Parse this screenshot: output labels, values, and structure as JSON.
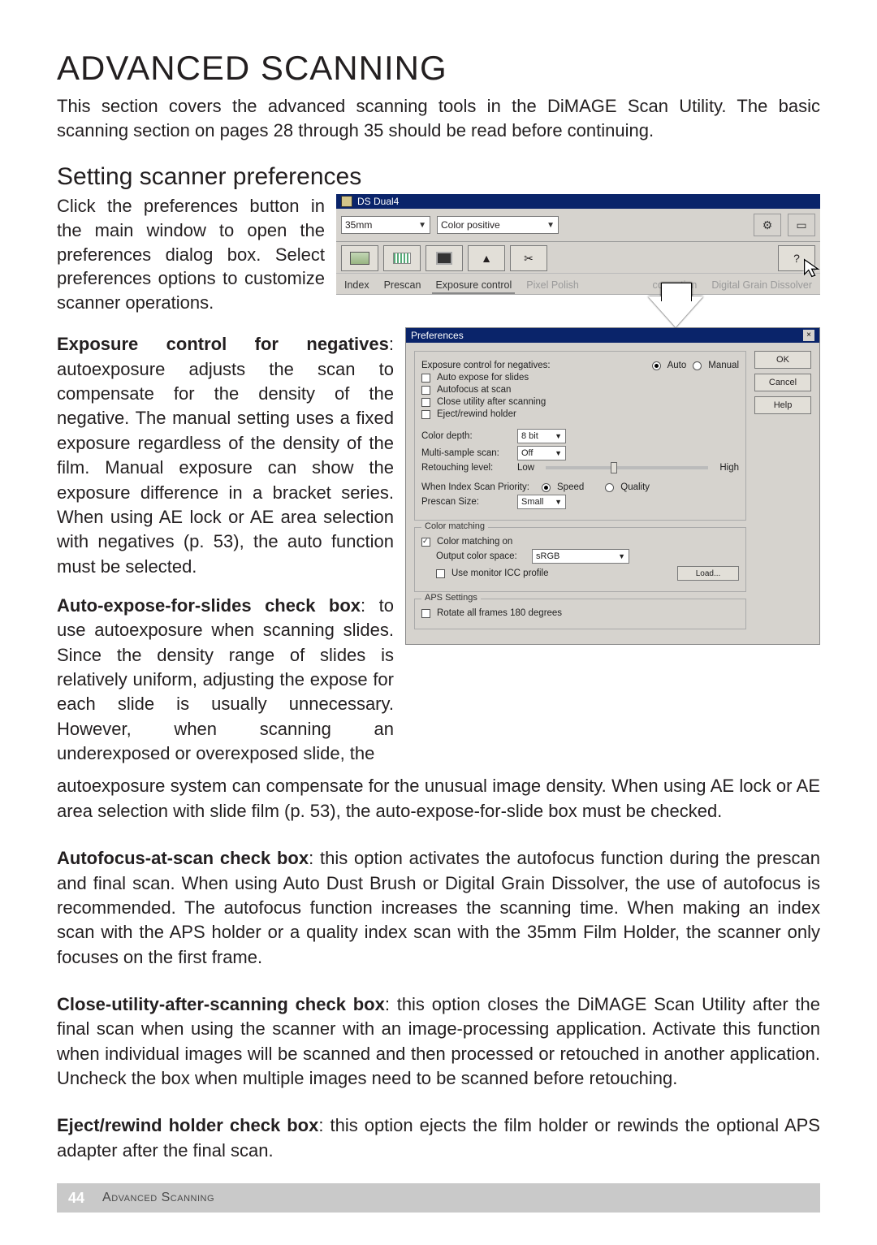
{
  "heading": "ADVANCED SCANNING",
  "intro": "This section covers the advanced scanning tools in the DiMAGE Scan Utility. The basic scanning section on pages 28 through 35 should be read before continuing.",
  "subheading": "Setting scanner preferences",
  "click_text": "Click the preferences button in the main window to open the preferences dialog box. Select preferences options to customize scanner operations.",
  "exposure": {
    "bold": "Exposure control for negatives",
    "text": ": autoexposure adjusts the scan to compensate for the density of the negative. The manual setting uses a fixed exposure regardless of the density of the film. Manual exposure can show the exposure difference in a bracket series. When using AE lock or AE area selection with negatives (p. 53), the auto function must be selected."
  },
  "autoexpose_slides": {
    "bold": "Auto-expose-for-slides check box",
    "text": ": to use autoexposure when scanning slides. Since the density range of slides is relatively uniform, adjusting the expose for each slide is usually unnecessary. However, when scanning an underexposed or overexposed slide, the"
  },
  "autoexpose_continued": "autoexposure system can compensate for the unusual image density. When using AE lock or AE area selection with slide film (p. 53), the auto-expose-for-slide box must be checked.",
  "autofocus": {
    "bold": "Autofocus-at-scan check box",
    "text": ": this option activates the autofocus function during the prescan and final scan. When using Auto Dust Brush or Digital Grain Dissolver, the use of autofocus is recommended. The autofocus function increases the scanning time. When making an index scan with the APS holder or a quality index scan with the 35mm Film Holder, the scanner only focuses on the first frame."
  },
  "close_util": {
    "bold": "Close-utility-after-scanning check box",
    "text": ": this option closes the DiMAGE Scan Utility after the final scan when using the scanner with an image-processing application. Activate this function when individual images will be scanned and then processed or retouched in another application. Uncheck the box when multiple images need to be scanned before retouching."
  },
  "eject": {
    "bold": "Eject/rewind holder check box",
    "text": ": this option ejects the film holder or rewinds the optional APS adapter after the final scan."
  },
  "footer": {
    "page": "44",
    "section": "Advanced Scanning"
  },
  "app": {
    "title": "DS Dual4",
    "film_format": "35mm",
    "film_type": "Color positive",
    "tabs": {
      "index": "Index",
      "prescan": "Prescan",
      "exposure": "Exposure control",
      "pixel": "Pixel Polish",
      "correction": "correction",
      "digital": "Digital Grain Dissolver"
    }
  },
  "pref": {
    "title": "Preferences",
    "ok": "OK",
    "cancel": "Cancel",
    "help": "Help",
    "exposure_label": "Exposure control for negatives:",
    "auto": "Auto",
    "manual": "Manual",
    "auto_expose_slides": "Auto expose for slides",
    "autofocus_at_scan": "Autofocus at scan",
    "close_utility": "Close utility after scanning",
    "eject_rewind": "Eject/rewind holder",
    "color_depth_label": "Color depth:",
    "color_depth_value": "8 bit",
    "multi_sample_label": "Multi-sample scan:",
    "multi_sample_value": "Off",
    "retouching_label": "Retouching level:",
    "low": "Low",
    "high": "High",
    "index_priority_label": "When Index Scan Priority:",
    "speed": "Speed",
    "quality": "Quality",
    "prescan_size_label": "Prescan Size:",
    "prescan_size_value": "Small",
    "color_matching_group": "Color matching",
    "color_matching_on": "Color matching on",
    "output_color_space": "Output color space:",
    "output_color_space_value": "sRGB",
    "use_monitor_icc": "Use monitor ICC profile",
    "load": "Load...",
    "aps_settings": "APS Settings",
    "rotate_all": "Rotate all frames 180 degrees"
  }
}
